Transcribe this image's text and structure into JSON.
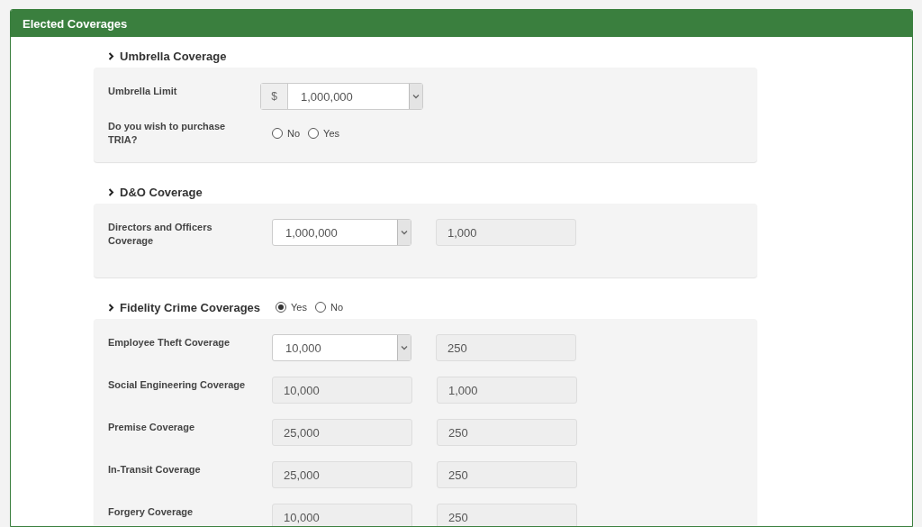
{
  "panel": {
    "title": "Elected Coverages"
  },
  "sections": [
    {
      "title": "Umbrella Coverage",
      "rows": [
        {
          "kind": "addon-select",
          "label": "Umbrella Limit",
          "addon": "$",
          "value": "1,000,000"
        },
        {
          "kind": "radios",
          "label": "Do you wish to purchase TRIA?",
          "options": [
            {
              "label": "No",
              "selected": false
            },
            {
              "label": "Yes",
              "selected": false
            }
          ]
        }
      ]
    },
    {
      "title": "D&O Coverage",
      "rows": [
        {
          "kind": "select-pair",
          "label": "Directors and Officers Coverage",
          "value": "1,000,000",
          "value_2": "1,000"
        }
      ]
    },
    {
      "title": "Fidelity Crime Coverages",
      "options": [
        {
          "label": "Yes",
          "selected": true
        },
        {
          "label": "No",
          "selected": false
        }
      ],
      "rows": [
        {
          "kind": "select-pair",
          "label": "Employee Theft Coverage",
          "value": "10,000",
          "value_2": "250"
        },
        {
          "kind": "readonly-pair",
          "label": "Social Engineering Coverage",
          "value": "10,000",
          "value_2": "1,000"
        },
        {
          "kind": "readonly-pair",
          "label": "Premise Coverage",
          "value": "25,000",
          "value_2": "250"
        },
        {
          "kind": "readonly-pair",
          "label": "In-Transit Coverage",
          "value": "25,000",
          "value_2": "250"
        },
        {
          "kind": "readonly-pair",
          "label": "Forgery Coverage",
          "value": "10,000",
          "value_2": "250"
        }
      ]
    }
  ]
}
